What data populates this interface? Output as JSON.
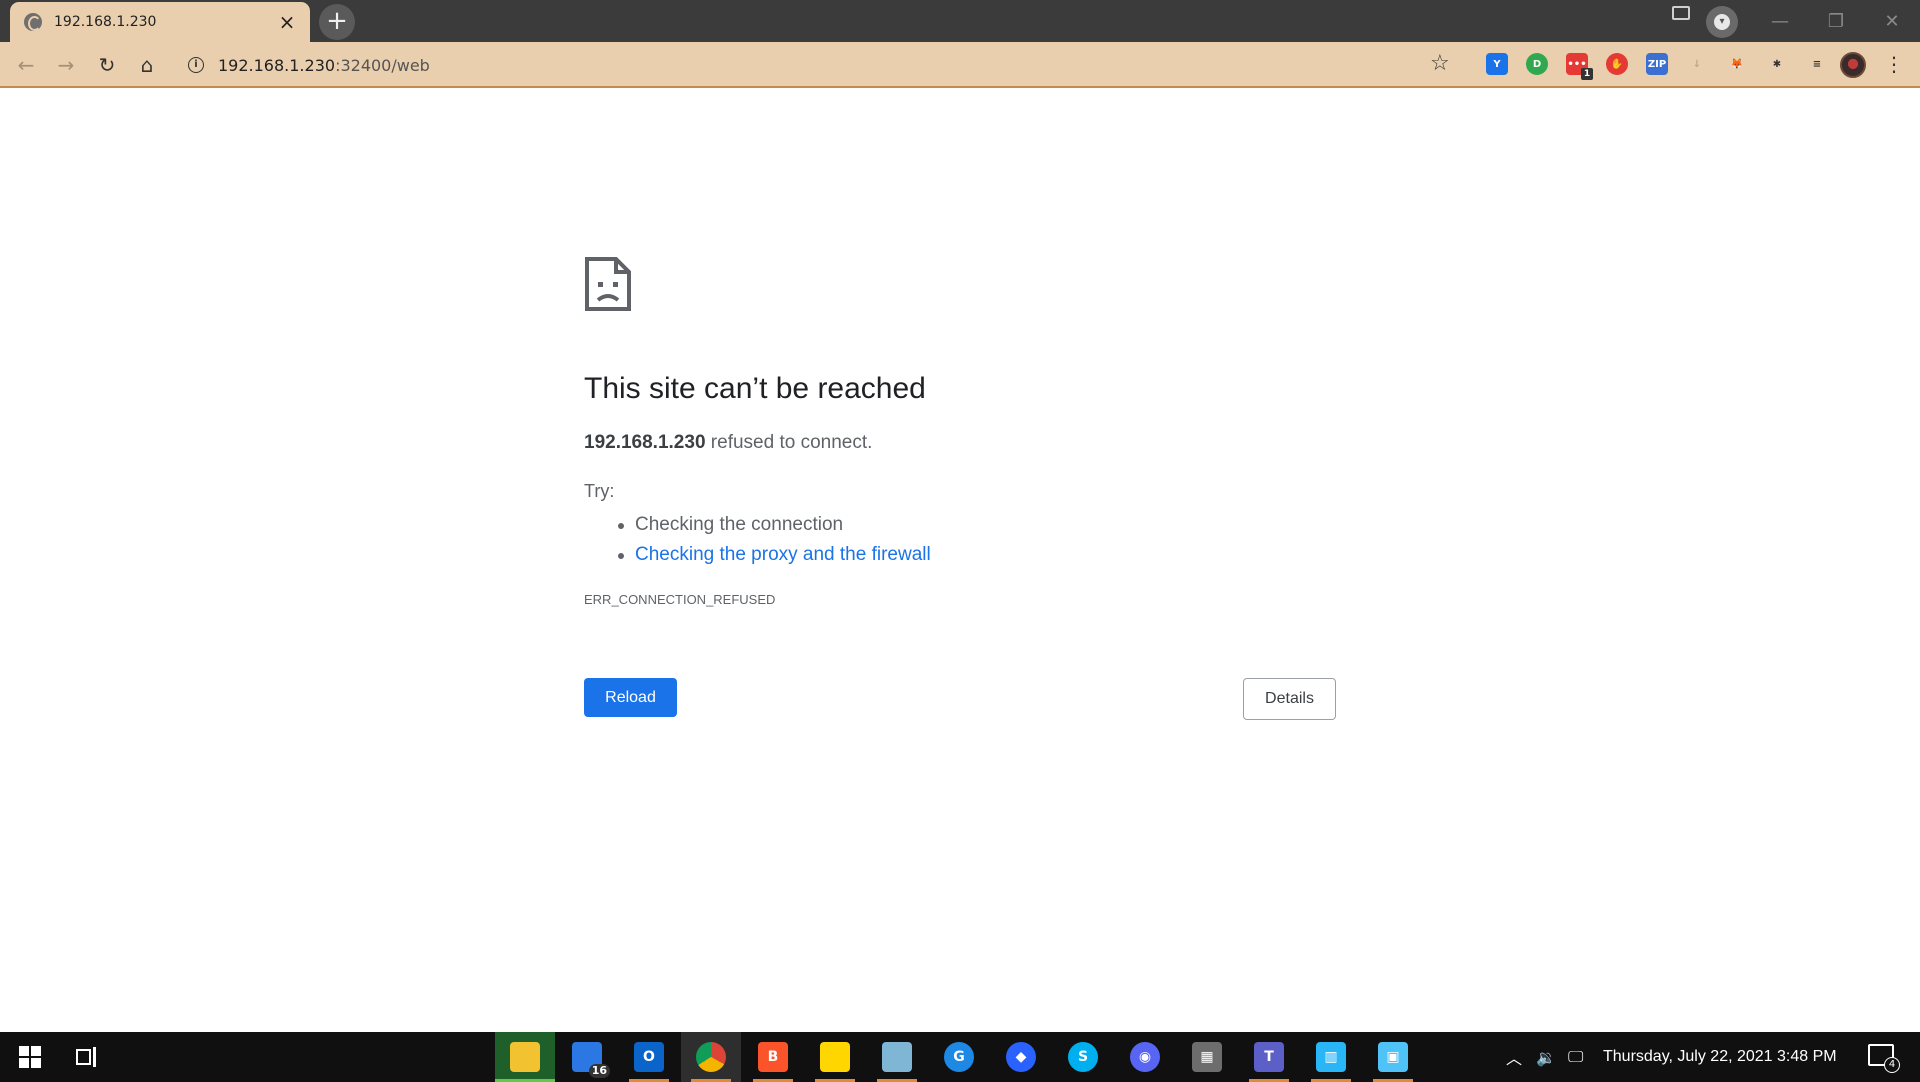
{
  "browser": {
    "tab": {
      "title": "192.168.1.230",
      "close_glyph": "×"
    },
    "new_tab_glyph": "+",
    "window_controls": {
      "minimize": "—",
      "restore": "❐",
      "close": "✕"
    },
    "omnibox": {
      "host": "192.168.1.230",
      "path": ":32400/web"
    },
    "extensions": [
      {
        "icon": "y-shield-icon",
        "color": "#1a73e8",
        "label": "Y"
      },
      {
        "icon": "green-d-icon",
        "color": "#2fa84f",
        "label": "D"
      },
      {
        "icon": "red-dots-icon",
        "color": "#e53935",
        "label": "•••",
        "badge": "1"
      },
      {
        "icon": "stop-hand-icon",
        "color": "#e53935",
        "label": "✋"
      },
      {
        "icon": "zip-icon",
        "color": "#3b6fd1",
        "label": "ZIP"
      },
      {
        "icon": "download-box-icon",
        "color": "#b9a78f",
        "label": "↓"
      },
      {
        "icon": "fox-icon",
        "color": "#e8821e",
        "label": "🦊"
      },
      {
        "icon": "puzzle-icon",
        "color": "#333333",
        "label": "✱"
      },
      {
        "icon": "media-queue-icon",
        "color": "#333333",
        "label": "≡"
      }
    ]
  },
  "error_page": {
    "title": "This site can’t be reached",
    "host": "192.168.1.230",
    "summary_rest": "refused to connect.",
    "try_label": "Try:",
    "suggestions": [
      "Checking the connection",
      "Checking the proxy and the firewall"
    ],
    "error_code": "ERR_CONNECTION_REFUSED",
    "reload_label": "Reload",
    "details_label": "Details"
  },
  "taskbar": {
    "apps": [
      {
        "name": "file-explorer",
        "icon": "folder-icon",
        "color": "#f2c230",
        "label": "",
        "state": "green"
      },
      {
        "name": "notepad",
        "icon": "document-icon",
        "color": "#2b78e4",
        "label": "",
        "badge": "16"
      },
      {
        "name": "outlook",
        "icon": "outlook-icon",
        "color": "#0a64c9",
        "label": "O",
        "state": "running"
      },
      {
        "name": "chrome",
        "icon": "chrome-icon",
        "color": "#db4437",
        "label": "",
        "state": "active"
      },
      {
        "name": "brave",
        "icon": "brave-icon",
        "color": "#fb542b",
        "label": "B",
        "state": "running"
      },
      {
        "name": "sticky-notes",
        "icon": "sticky-note-icon",
        "color": "#ffd600",
        "label": "",
        "state": "running"
      },
      {
        "name": "pen-app",
        "icon": "pen-icon",
        "color": "#7fb6d6",
        "label": "",
        "state": "running"
      },
      {
        "name": "g-app",
        "icon": "g-circle-icon",
        "color": "#1e88e5",
        "label": "G"
      },
      {
        "name": "compass-app",
        "icon": "compass-icon",
        "color": "#2962ff",
        "label": "◆"
      },
      {
        "name": "skype",
        "icon": "skype-icon",
        "color": "#00aff0",
        "label": "S"
      },
      {
        "name": "discord",
        "icon": "discord-icon",
        "color": "#5865f2",
        "label": "◉"
      },
      {
        "name": "calculator",
        "icon": "calculator-icon",
        "color": "#6d6d6d",
        "label": "▦"
      },
      {
        "name": "teams",
        "icon": "teams-icon",
        "color": "#5b5fc7",
        "label": "T",
        "state": "running"
      },
      {
        "name": "building-app",
        "icon": "building-icon",
        "color": "#29b6f6",
        "label": "▥",
        "state": "running"
      },
      {
        "name": "network-app",
        "icon": "network-monitor-icon",
        "color": "#4fc3f7",
        "label": "▣",
        "state": "running"
      }
    ],
    "clock": "Thursday, July 22, 2021 3:48 PM",
    "notifications_count": "4"
  }
}
